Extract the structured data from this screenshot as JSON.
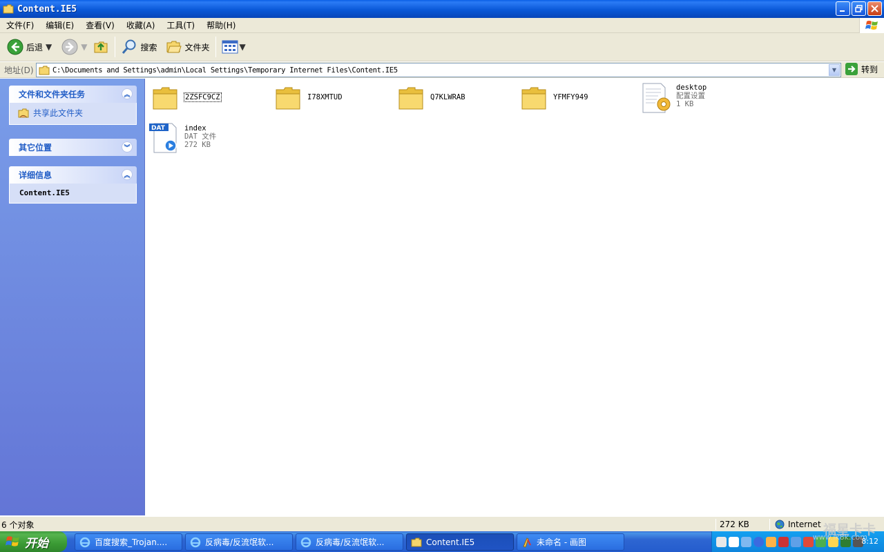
{
  "window": {
    "title": "Content.IE5"
  },
  "menu": [
    "文件(F)",
    "编辑(E)",
    "查看(V)",
    "收藏(A)",
    "工具(T)",
    "帮助(H)"
  ],
  "toolbar": {
    "back": "后退",
    "search": "搜索",
    "folders": "文件夹"
  },
  "address": {
    "label": "地址(D)",
    "path": "C:\\Documents and Settings\\admin\\Local Settings\\Temporary Internet Files\\Content.IE5",
    "go": "转到"
  },
  "taskpane": {
    "tasks": {
      "title": "文件和文件夹任务",
      "items": [
        "共享此文件夹"
      ]
    },
    "other": {
      "title": "其它位置"
    },
    "details": {
      "title": "详细信息",
      "name": "Content.IE5"
    }
  },
  "files": [
    {
      "name": "2ZSFC9CZ",
      "type": "folder"
    },
    {
      "name": "I78XMTUD",
      "type": "folder"
    },
    {
      "name": "Q7KLWRAB",
      "type": "folder"
    },
    {
      "name": "YFMFY949",
      "type": "folder"
    },
    {
      "name": "desktop",
      "kind": "配置设置",
      "size": "1 KB",
      "type": "ini"
    },
    {
      "name": "index",
      "kind": "DAT 文件",
      "size": "272 KB",
      "type": "dat",
      "icon_label": "DAT"
    }
  ],
  "status": {
    "count": "6 个对象",
    "size": "272 KB",
    "zone": "Internet"
  },
  "taskbar": {
    "start": "开始",
    "items": [
      "百度搜索_Trojan....",
      "反病毒/反流氓软...",
      "反病毒/反流氓软...",
      "Content.IE5",
      "未命名 - 画图"
    ],
    "clock": "8:12"
  },
  "watermark": {
    "main": "福星卡卡",
    "url": "www.ik8k.com"
  }
}
